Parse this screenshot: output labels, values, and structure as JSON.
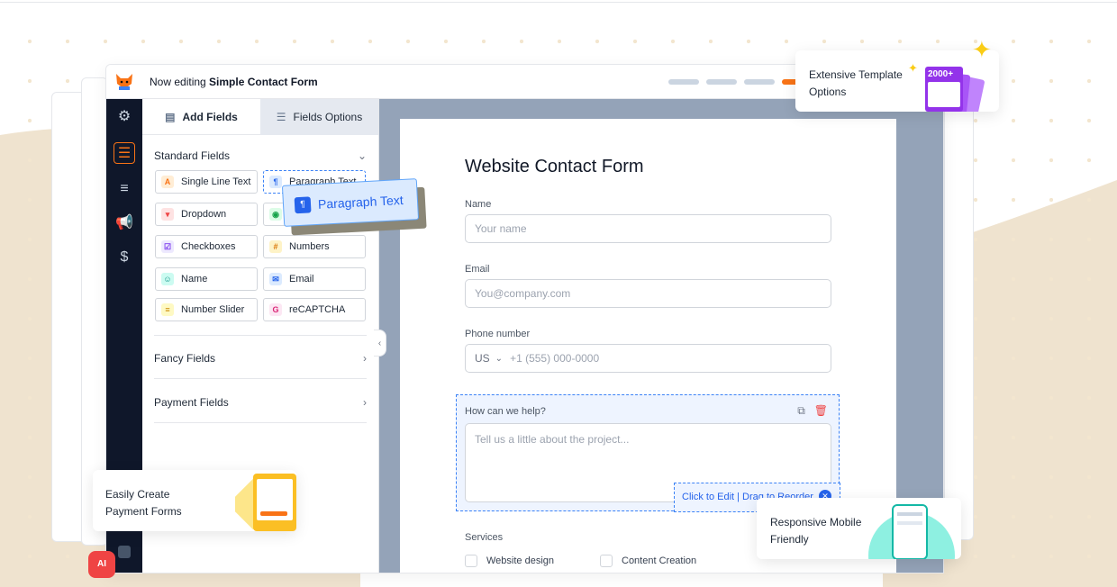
{
  "header": {
    "title_prefix": "Now editing",
    "form_name": "Simple Contact Form"
  },
  "tabs": {
    "add_fields": "Add Fields",
    "fields_options": "Fields Options"
  },
  "sections": {
    "standard": "Standard Fields",
    "fancy": "Fancy Fields",
    "payment": "Payment Fields"
  },
  "fields": [
    {
      "label": "Single Line Text",
      "icon": "text-icon",
      "glyph": "A"
    },
    {
      "label": "Paragraph Text",
      "icon": "paragraph-icon",
      "glyph": "¶"
    },
    {
      "label": "Dropdown",
      "icon": "dropdown-icon",
      "glyph": "▾"
    },
    {
      "label": "",
      "icon": "radio-icon",
      "glyph": "◉"
    },
    {
      "label": "Checkboxes",
      "icon": "checkbox-icon",
      "glyph": "☑"
    },
    {
      "label": "Numbers",
      "icon": "hash-icon",
      "glyph": "#"
    },
    {
      "label": "Name",
      "icon": "user-icon",
      "glyph": "☺"
    },
    {
      "label": "Email",
      "icon": "email-icon",
      "glyph": "✉"
    },
    {
      "label": "Number Slider",
      "icon": "slider-icon",
      "glyph": "≡"
    },
    {
      "label": "reCAPTCHA",
      "icon": "recaptcha-icon",
      "glyph": "G"
    }
  ],
  "drag_card": {
    "label": "Paragraph Text"
  },
  "form": {
    "title": "Website Contact Form",
    "name_label": "Name",
    "name_placeholder": "Your name",
    "email_label": "Email",
    "email_placeholder": "You@company.com",
    "phone_label": "Phone number",
    "phone_country": "US",
    "phone_placeholder": "+1 (555) 000-0000",
    "help_label": "How can we help?",
    "help_placeholder": "Tell us a little about the project...",
    "edit_hint": "Click to Edit | Drag to Reorder",
    "services_label": "Services",
    "services": [
      "Website design",
      "Content Creation"
    ]
  },
  "callouts": {
    "templates_line1": "Extensive Template",
    "templates_line2": "Options",
    "templates_badge": "2000+",
    "payment_line1": "Easily Create",
    "payment_line2": "Payment Forms",
    "mobile_line1": "Responsive Mobile",
    "mobile_line2": "Friendly"
  },
  "ai_badge": "AI",
  "colors": {
    "accent": "#f97316",
    "nav_bg": "#0f172a",
    "canvas_bg": "#94a3b8",
    "link_blue": "#2563eb"
  }
}
